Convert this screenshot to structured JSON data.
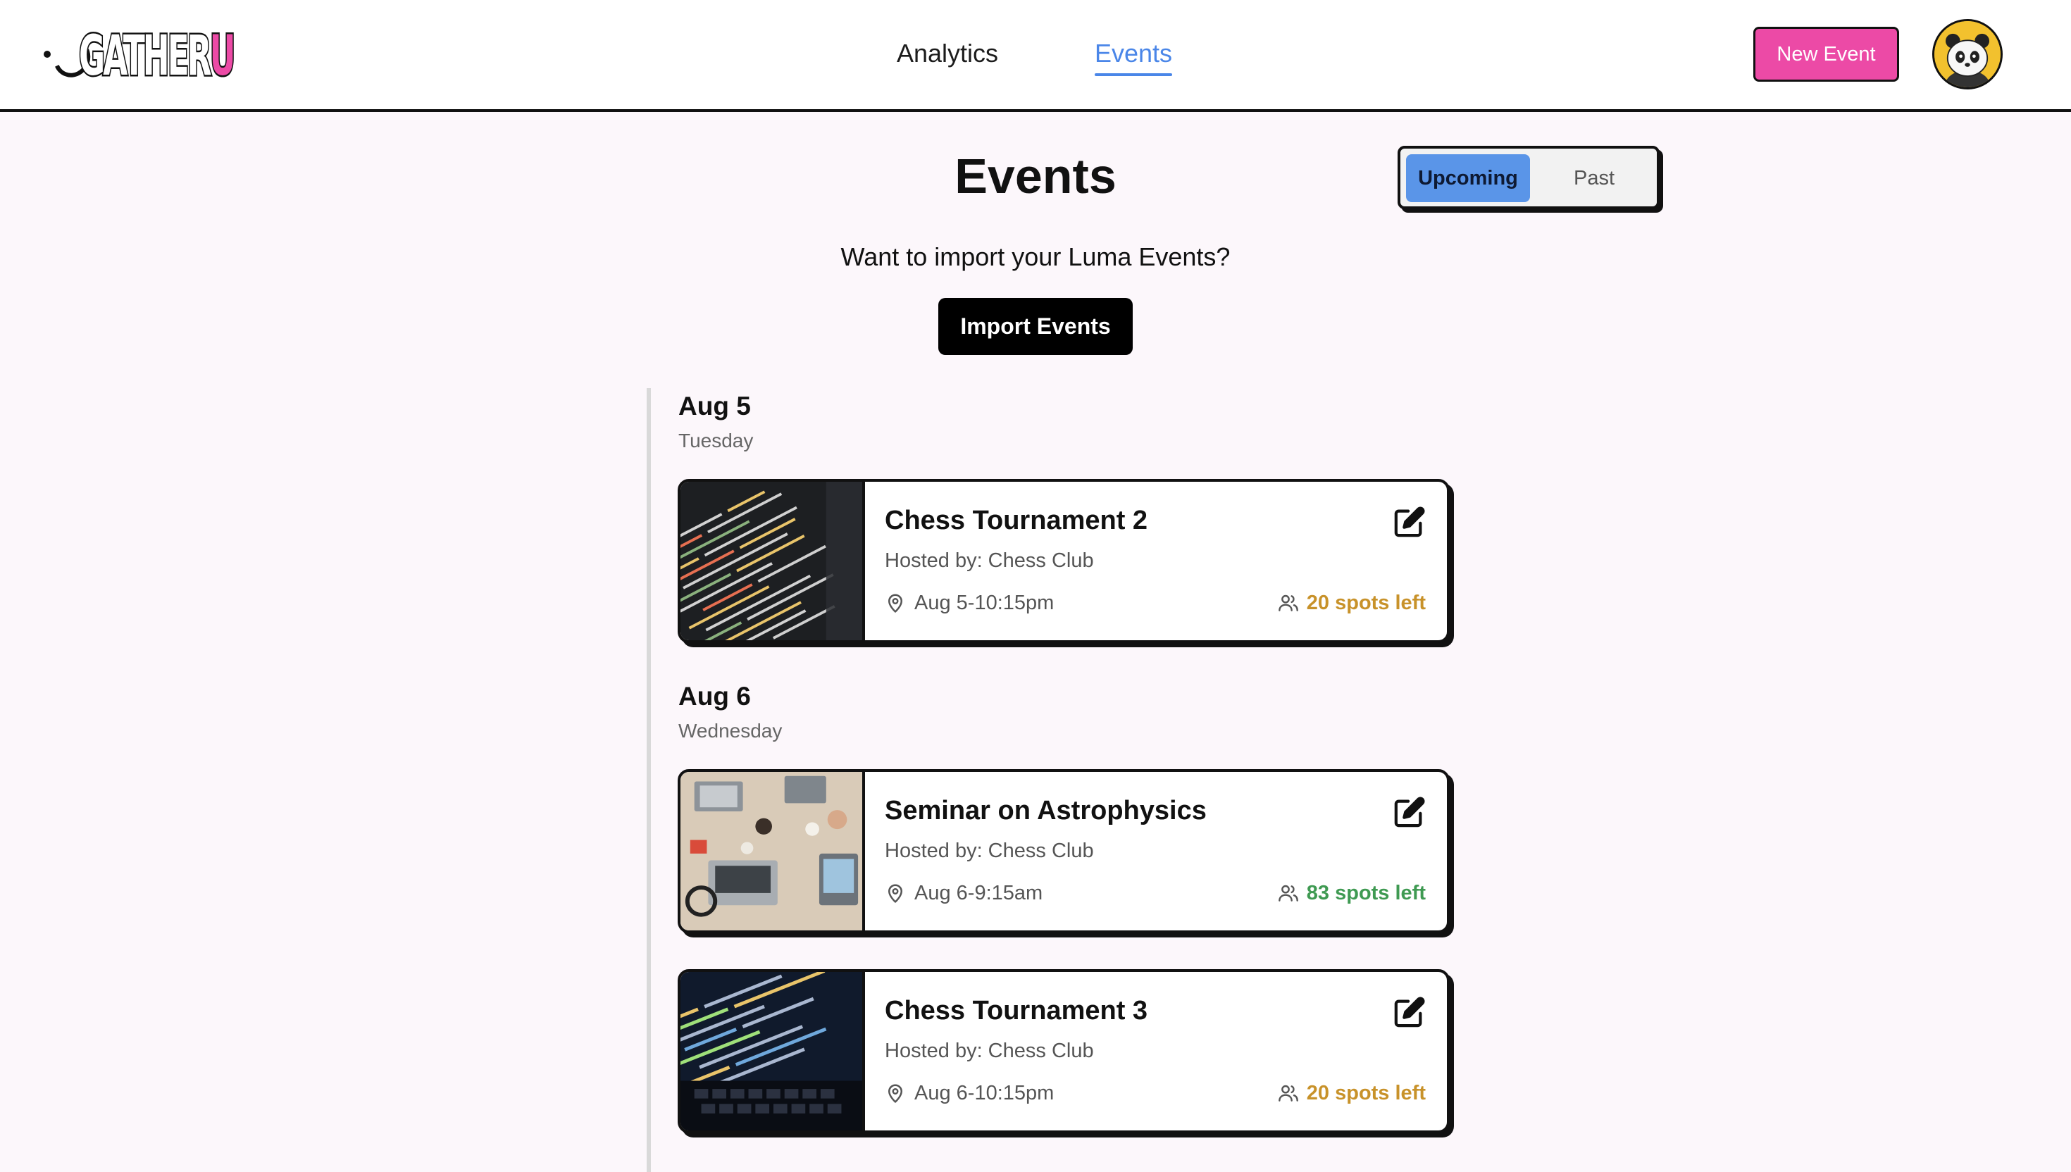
{
  "header": {
    "logo_text": "GATHERU",
    "nav": [
      {
        "label": "Analytics"
      },
      {
        "label": "Events"
      }
    ],
    "new_event_label": "New Event",
    "accent_color": "#ec4aa6",
    "active_nav_color": "#4a86e8"
  },
  "page": {
    "title": "Events",
    "toggle": {
      "upcoming_label": "Upcoming",
      "past_label": "Past",
      "selected": "Upcoming"
    },
    "import_prompt": "Want to import your Luma Events?",
    "import_button_label": "Import Events"
  },
  "timeline": [
    {
      "date": "Aug 5",
      "weekday": "Tuesday",
      "events": [
        {
          "title": "Chess Tournament 2",
          "host": "Hosted by: Chess Club",
          "time": "Aug 5-10:15pm",
          "spots": "20 spots left",
          "spots_color": "#c8922a",
          "thumbnail": "code-on-screen"
        }
      ]
    },
    {
      "date": "Aug 6",
      "weekday": "Wednesday",
      "events": [
        {
          "title": "Seminar on Astrophysics",
          "host": "Hosted by: Chess Club",
          "time": "Aug 6-9:15am",
          "spots": "83 spots left",
          "spots_color": "#3f9a52",
          "thumbnail": "desk-with-laptops"
        },
        {
          "title": "Chess Tournament 3",
          "host": "Hosted by: Chess Club",
          "time": "Aug 6-10:15pm",
          "spots": "20 spots left",
          "spots_color": "#c8922a",
          "thumbnail": "laptop-code"
        }
      ]
    }
  ],
  "icons": [
    "edit-icon",
    "location-pin-icon",
    "users-icon",
    "panda-avatar"
  ]
}
